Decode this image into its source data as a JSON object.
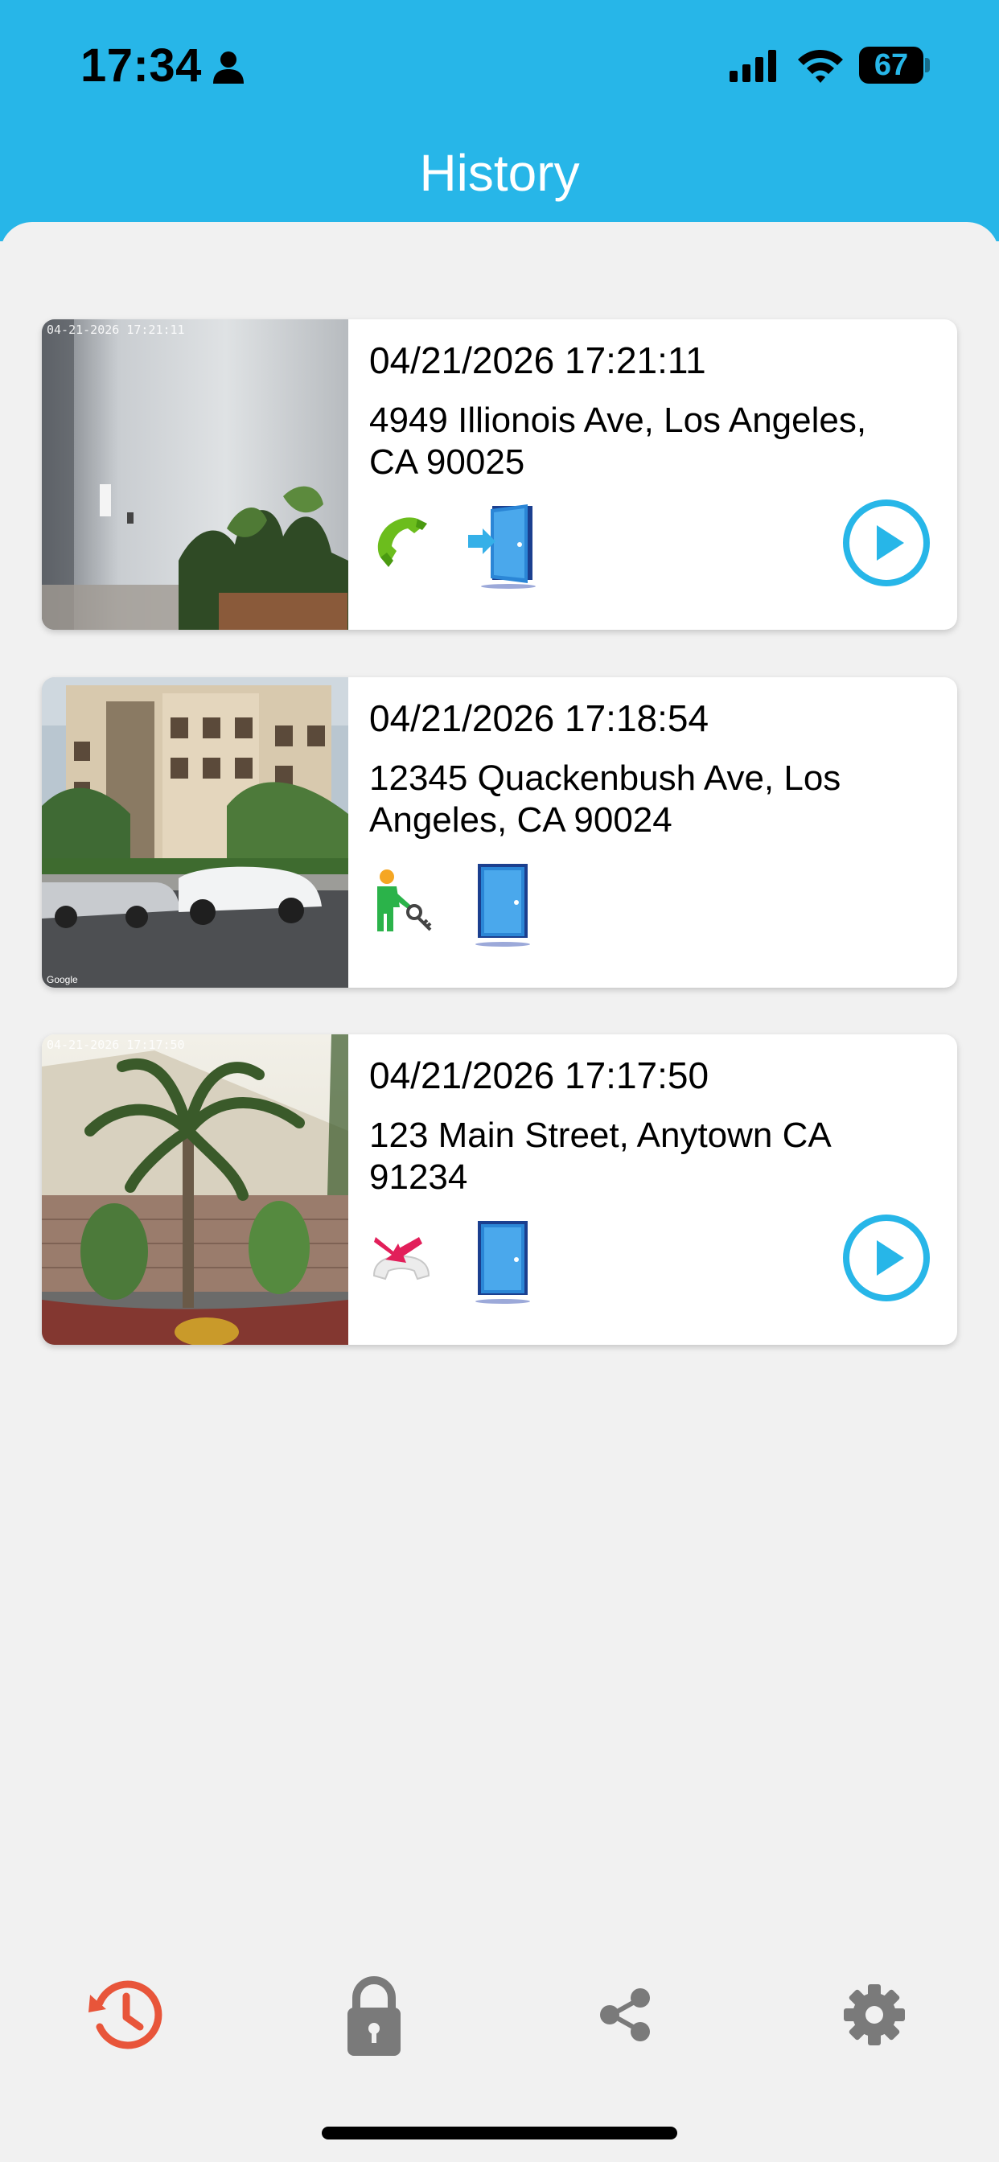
{
  "status_bar": {
    "time": "17:34",
    "battery": "67"
  },
  "header": {
    "title": "History"
  },
  "history": [
    {
      "datetime": "04/21/2026 17:21:11",
      "address": "4949 Illionois Ave, Los Angeles, CA 90025",
      "event_icon": "answered-call-icon",
      "door_icon": "door-enter-icon",
      "has_video": true
    },
    {
      "datetime": "04/21/2026 17:18:54",
      "address": "12345 Quackenbush Ave, Los Angeles, CA 90024",
      "event_icon": "key-person-icon",
      "door_icon": "door-icon",
      "has_video": false
    },
    {
      "datetime": "04/21/2026 17:17:50",
      "address": "123 Main Street, Anytown CA 91234",
      "event_icon": "missed-call-icon",
      "door_icon": "door-icon",
      "has_video": true
    }
  ],
  "tabbar": {
    "tabs": [
      {
        "name": "history",
        "icon": "history-icon",
        "active": true
      },
      {
        "name": "lock",
        "icon": "lock-icon",
        "active": false
      },
      {
        "name": "share",
        "icon": "share-icon",
        "active": false
      },
      {
        "name": "settings",
        "icon": "gear-icon",
        "active": false
      }
    ]
  },
  "colors": {
    "header": "#27b6e8",
    "accent": "#27b6e8",
    "active_tab": "#e8553a",
    "inactive_tab": "#7a7a7a"
  }
}
